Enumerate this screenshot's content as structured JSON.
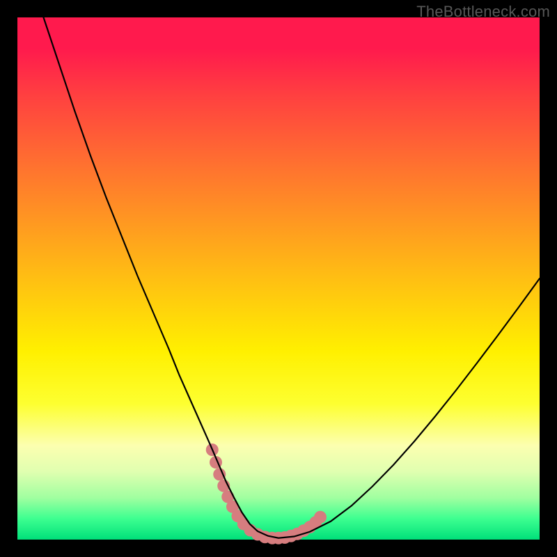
{
  "watermark": "TheBottleneck.com",
  "chart_data": {
    "type": "line",
    "title": "",
    "xlabel": "",
    "ylabel": "",
    "xlim": [
      0,
      100
    ],
    "ylim": [
      0,
      100
    ],
    "grid": false,
    "legend": false,
    "series": [
      {
        "name": "bottleneck-curve",
        "color": "#000000",
        "x": [
          5,
          8,
          11,
          14,
          17,
          20,
          23,
          26,
          29,
          31,
          33,
          35,
          37,
          38.5,
          40,
          41.5,
          43,
          44.5,
          46,
          48,
          50,
          53,
          56,
          60,
          64,
          68,
          72,
          76,
          80,
          84,
          88,
          92,
          96,
          100
        ],
        "y": [
          100,
          91,
          82,
          73.5,
          65.5,
          58,
          50.5,
          43.5,
          36.5,
          31.5,
          27,
          22.5,
          18,
          14.5,
          11,
          8,
          5.2,
          3.0,
          1.6,
          0.7,
          0.3,
          0.6,
          1.5,
          3.5,
          6.5,
          10.2,
          14.3,
          18.8,
          23.6,
          28.6,
          33.8,
          39.1,
          44.5,
          50
        ]
      },
      {
        "name": "highlight-dots",
        "color": "#d67d7f",
        "x": [
          37.3,
          38.0,
          38.7,
          39.5,
          40.3,
          41.2,
          42.2,
          43.3,
          44.6,
          46.0,
          47.4,
          48.8,
          50.0,
          51.2,
          52.4,
          53.6,
          54.8,
          56.0,
          57.1,
          58.0
        ],
        "y": [
          17.2,
          14.8,
          12.5,
          10.3,
          8.2,
          6.3,
          4.5,
          3.0,
          1.8,
          1.0,
          0.5,
          0.3,
          0.3,
          0.4,
          0.7,
          1.1,
          1.7,
          2.4,
          3.3,
          4.3
        ]
      }
    ],
    "gradient_stops": [
      {
        "pos": 0.0,
        "color": "#ff1a4d"
      },
      {
        "pos": 0.5,
        "color": "#ffd000"
      },
      {
        "pos": 0.82,
        "color": "#fcffb0"
      },
      {
        "pos": 1.0,
        "color": "#00e07a"
      }
    ]
  }
}
